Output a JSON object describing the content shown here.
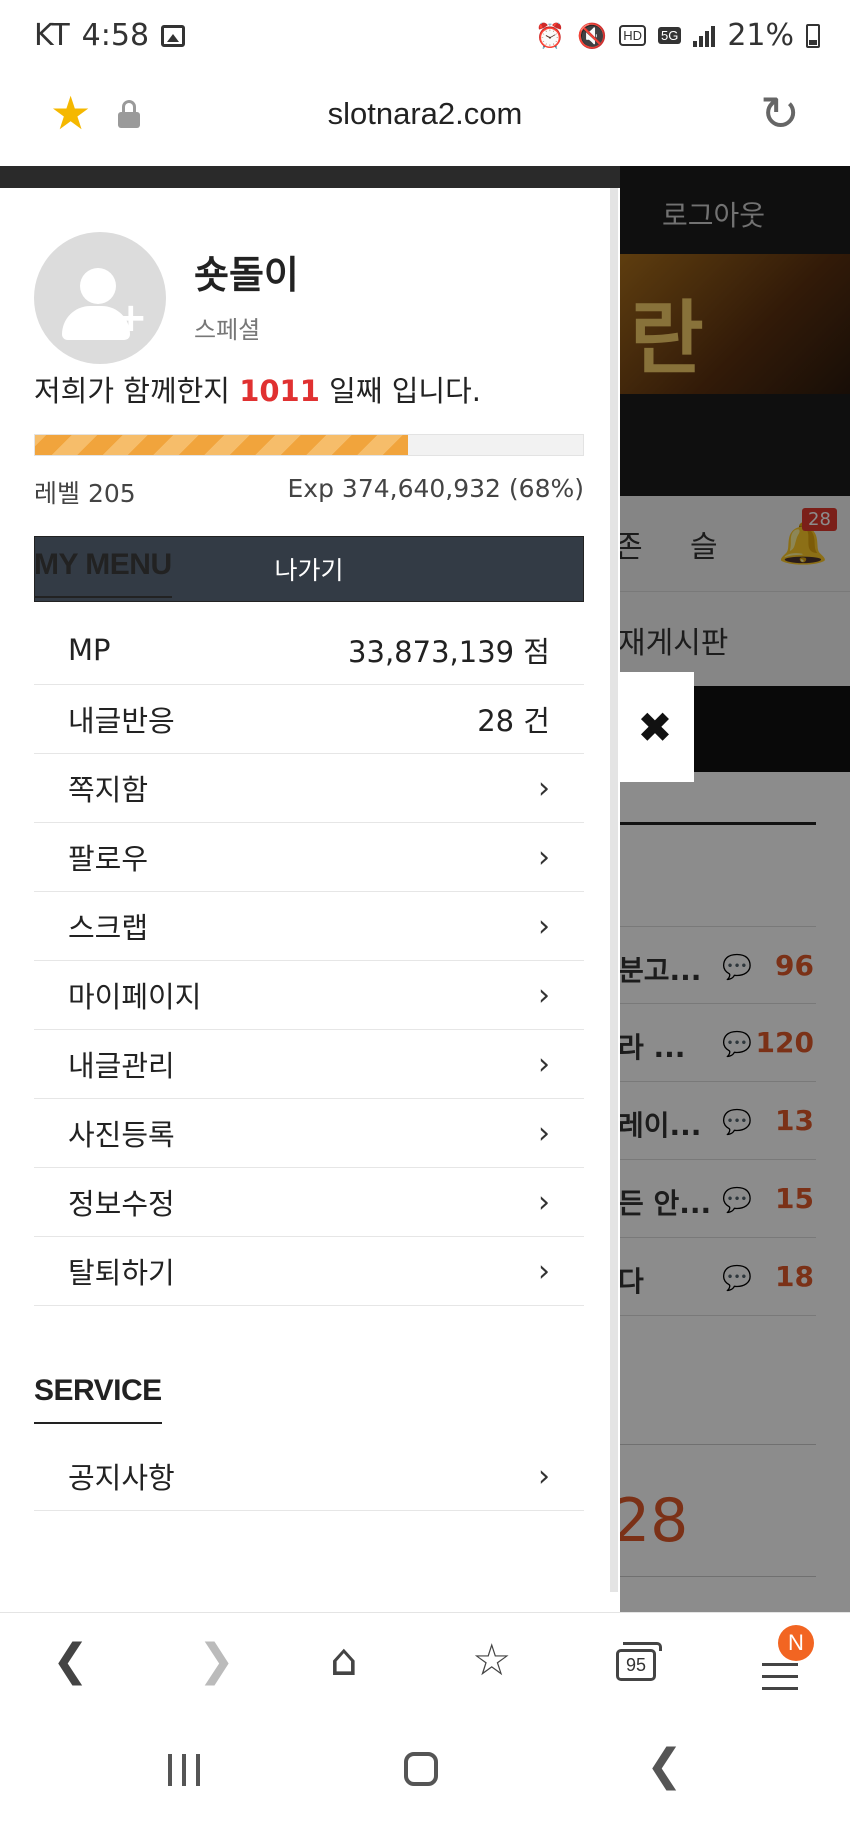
{
  "status_bar": {
    "carrier": "KT",
    "time": "4:58",
    "hd": "HD",
    "network": "5G",
    "battery": "21%"
  },
  "address_bar": {
    "url": "slotnara2.com"
  },
  "background_page": {
    "logout": "로그아웃",
    "banner_text": "란",
    "nav_item_1": "존",
    "nav_item_2": "슬",
    "bell_badge": "28",
    "board_title": "재게시판",
    "posts": [
      {
        "title": "분고...",
        "count": "96"
      },
      {
        "title": "라 ...",
        "count": "120"
      },
      {
        "title": "레이...",
        "count": "13"
      },
      {
        "title": "든 안...",
        "count": "15"
      },
      {
        "title": "다",
        "count": "18"
      }
    ],
    "big_count": "28"
  },
  "drawer": {
    "nickname": "숏돌이",
    "rank": "스페셜",
    "days_prefix": "저희가 함께한지",
    "days_count": "1011",
    "days_suffix": "일째 입니다.",
    "progress_percent": 68,
    "level": "레벨 205",
    "exp": "Exp 374,640,932 (68%)",
    "exit_button": "나가기",
    "my_menu_title": "MY MENU",
    "my_menu": [
      {
        "label": "MP",
        "value": "33,873,139 점"
      },
      {
        "label": "내글반응",
        "value": "28 건"
      },
      {
        "label": "쪽지함"
      },
      {
        "label": "팔로우"
      },
      {
        "label": "스크랩"
      },
      {
        "label": "마이페이지"
      },
      {
        "label": "내글관리"
      },
      {
        "label": "사진등록"
      },
      {
        "label": "정보수정"
      },
      {
        "label": "탈퇴하기"
      }
    ],
    "service_title": "SERVICE",
    "service_menu": [
      {
        "label": "공지사항"
      }
    ]
  },
  "toolbar": {
    "tabs_count": "95",
    "menu_badge": "N"
  }
}
